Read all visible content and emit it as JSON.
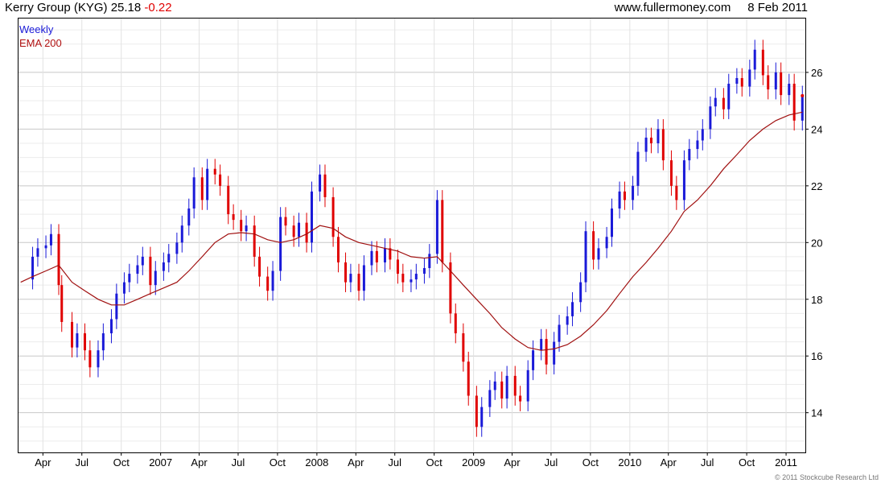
{
  "header": {
    "company": "Kerry Group (KYG)",
    "price": "25.18",
    "change": "-0.22",
    "source": "www.fullermoney.com",
    "date": "8 Feb 2011"
  },
  "legend": {
    "series1": "Weekly",
    "series2": "EMA 200"
  },
  "copyright": "© 2011 Stockcube Research Ltd",
  "colors": {
    "up": "#1a1ad8",
    "down": "#e00000",
    "ema": "#a01010",
    "grid": "#cccccc"
  },
  "chart_data": {
    "type": "line",
    "title": "Kerry Group (KYG) 25.18 -0.22",
    "y_axis_position": "right",
    "ylim": [
      12.6,
      27.9
    ],
    "y_ticks": [
      14,
      16,
      18,
      20,
      22,
      24,
      26
    ],
    "grid": true,
    "legend_placement": "top-left",
    "x_ticks": [
      {
        "label": "Apr",
        "date": "2006-04"
      },
      {
        "label": "Jul",
        "date": "2006-07"
      },
      {
        "label": "Oct",
        "date": "2006-10"
      },
      {
        "label": "2007",
        "date": "2007-01"
      },
      {
        "label": "Apr",
        "date": "2007-04"
      },
      {
        "label": "Jul",
        "date": "2007-07"
      },
      {
        "label": "Oct",
        "date": "2007-10"
      },
      {
        "label": "2008",
        "date": "2008-01"
      },
      {
        "label": "Apr",
        "date": "2008-04"
      },
      {
        "label": "Jul",
        "date": "2008-07"
      },
      {
        "label": "Oct",
        "date": "2008-10"
      },
      {
        "label": "2009",
        "date": "2009-01"
      },
      {
        "label": "Apr",
        "date": "2009-04"
      },
      {
        "label": "Jul",
        "date": "2009-07"
      },
      {
        "label": "Oct",
        "date": "2009-10"
      },
      {
        "label": "2010",
        "date": "2010-01"
      },
      {
        "label": "Apr",
        "date": "2010-04"
      },
      {
        "label": "Jul",
        "date": "2010-07"
      },
      {
        "label": "Oct",
        "date": "2010-10"
      },
      {
        "label": "2011",
        "date": "2011-01"
      }
    ],
    "series": [
      {
        "name": "Weekly",
        "kind": "close",
        "points": [
          [
            "2006-02",
            18.7
          ],
          [
            "2006-03",
            19.5
          ],
          [
            "2006-03-20",
            19.8
          ],
          [
            "2006-04",
            19.9
          ],
          [
            "2006-04-20",
            20.3
          ],
          [
            "2006-05",
            18.5
          ],
          [
            "2006-05-15",
            17.2
          ],
          [
            "2006-06",
            16.3
          ],
          [
            "2006-06-20",
            16.8
          ],
          [
            "2006-07",
            16.2
          ],
          [
            "2006-07-20",
            15.6
          ],
          [
            "2006-08",
            16.2
          ],
          [
            "2006-08-20",
            16.8
          ],
          [
            "2006-09",
            17.3
          ],
          [
            "2006-09-20",
            18.2
          ],
          [
            "2006-10",
            18.6
          ],
          [
            "2006-10-20",
            18.9
          ],
          [
            "2006-11",
            19.2
          ],
          [
            "2006-11-20",
            19.5
          ],
          [
            "2006-12",
            18.5
          ],
          [
            "2006-12-20",
            19.0
          ],
          [
            "2007-01",
            19.3
          ],
          [
            "2007-01-20",
            19.6
          ],
          [
            "2007-02",
            20.0
          ],
          [
            "2007-02-20",
            20.6
          ],
          [
            "2007-03",
            21.2
          ],
          [
            "2007-03-20",
            22.3
          ],
          [
            "2007-04",
            21.5
          ],
          [
            "2007-04-20",
            22.6
          ],
          [
            "2007-05",
            22.4
          ],
          [
            "2007-05-20",
            22.0
          ],
          [
            "2007-06",
            21.0
          ],
          [
            "2007-06-20",
            20.8
          ],
          [
            "2007-07",
            20.4
          ],
          [
            "2007-07-20",
            20.6
          ],
          [
            "2007-08",
            19.5
          ],
          [
            "2007-08-20",
            18.8
          ],
          [
            "2007-09",
            18.3
          ],
          [
            "2007-09-20",
            19.0
          ],
          [
            "2007-10",
            20.9
          ],
          [
            "2007-10-20",
            20.6
          ],
          [
            "2007-11",
            20.2
          ],
          [
            "2007-11-20",
            20.7
          ],
          [
            "2007-12",
            20.0
          ],
          [
            "2007-12-20",
            21.8
          ],
          [
            "2008-01",
            22.4
          ],
          [
            "2008-01-20",
            21.6
          ],
          [
            "2008-02",
            20.2
          ],
          [
            "2008-02-20",
            19.3
          ],
          [
            "2008-03",
            18.6
          ],
          [
            "2008-03-20",
            18.9
          ],
          [
            "2008-04",
            18.3
          ],
          [
            "2008-04-20",
            19.2
          ],
          [
            "2008-05",
            19.7
          ],
          [
            "2008-05-20",
            19.3
          ],
          [
            "2008-06",
            19.8
          ],
          [
            "2008-06-20",
            19.4
          ],
          [
            "2008-07",
            18.9
          ],
          [
            "2008-07-20",
            18.6
          ],
          [
            "2008-08",
            18.7
          ],
          [
            "2008-08-20",
            18.9
          ],
          [
            "2008-09",
            19.1
          ],
          [
            "2008-09-20",
            19.6
          ],
          [
            "2008-10",
            21.5
          ],
          [
            "2008-10-20",
            19.3
          ],
          [
            "2008-11",
            17.5
          ],
          [
            "2008-11-20",
            16.8
          ],
          [
            "2008-12",
            15.8
          ],
          [
            "2008-12-20",
            14.6
          ],
          [
            "2009-01",
            13.5
          ],
          [
            "2009-01-20",
            14.2
          ],
          [
            "2009-02",
            14.8
          ],
          [
            "2009-02-20",
            15.1
          ],
          [
            "2009-03",
            14.5
          ],
          [
            "2009-03-20",
            15.3
          ],
          [
            "2009-04",
            14.6
          ],
          [
            "2009-04-20",
            14.4
          ],
          [
            "2009-05",
            15.5
          ],
          [
            "2009-05-20",
            16.2
          ],
          [
            "2009-06",
            16.6
          ],
          [
            "2009-06-20",
            15.7
          ],
          [
            "2009-07",
            16.5
          ],
          [
            "2009-07-20",
            17.1
          ],
          [
            "2009-08",
            17.4
          ],
          [
            "2009-08-20",
            17.9
          ],
          [
            "2009-09",
            18.6
          ],
          [
            "2009-09-20",
            20.4
          ],
          [
            "2009-10",
            19.4
          ],
          [
            "2009-10-20",
            19.8
          ],
          [
            "2009-11",
            20.2
          ],
          [
            "2009-11-20",
            21.2
          ],
          [
            "2009-12",
            21.8
          ],
          [
            "2009-12-20",
            21.5
          ],
          [
            "2010-01",
            22.0
          ],
          [
            "2010-01-20",
            23.2
          ],
          [
            "2010-02",
            23.7
          ],
          [
            "2010-02-20",
            23.5
          ],
          [
            "2010-03",
            24.0
          ],
          [
            "2010-03-20",
            22.9
          ],
          [
            "2010-04",
            22.0
          ],
          [
            "2010-04-20",
            21.5
          ],
          [
            "2010-05",
            22.9
          ],
          [
            "2010-05-20",
            23.3
          ],
          [
            "2010-06",
            23.6
          ],
          [
            "2010-06-20",
            24.0
          ],
          [
            "2010-07",
            24.8
          ],
          [
            "2010-07-20",
            25.1
          ],
          [
            "2010-08",
            24.7
          ],
          [
            "2010-08-20",
            25.6
          ],
          [
            "2010-09",
            25.8
          ],
          [
            "2010-09-20",
            25.5
          ],
          [
            "2010-10",
            26.1
          ],
          [
            "2010-10-20",
            26.8
          ],
          [
            "2010-11",
            25.9
          ],
          [
            "2010-11-20",
            25.4
          ],
          [
            "2010-12",
            26.0
          ],
          [
            "2010-12-20",
            25.2
          ],
          [
            "2011-01",
            25.6
          ],
          [
            "2011-01-20",
            24.3
          ],
          [
            "2011-02",
            25.18
          ]
        ]
      },
      {
        "name": "EMA 200",
        "points": [
          [
            "2006-02",
            18.6
          ],
          [
            "2006-03",
            18.8
          ],
          [
            "2006-04",
            19.0
          ],
          [
            "2006-05",
            19.2
          ],
          [
            "2006-06",
            18.6
          ],
          [
            "2006-07",
            18.3
          ],
          [
            "2006-08",
            18.0
          ],
          [
            "2006-09",
            17.8
          ],
          [
            "2006-10",
            17.8
          ],
          [
            "2006-11",
            18.0
          ],
          [
            "2006-12",
            18.2
          ],
          [
            "2007-01",
            18.4
          ],
          [
            "2007-02",
            18.6
          ],
          [
            "2007-03",
            19.0
          ],
          [
            "2007-04",
            19.5
          ],
          [
            "2007-05",
            20.0
          ],
          [
            "2007-06",
            20.3
          ],
          [
            "2007-07",
            20.35
          ],
          [
            "2007-08",
            20.3
          ],
          [
            "2007-09",
            20.1
          ],
          [
            "2007-10",
            20.0
          ],
          [
            "2007-11",
            20.1
          ],
          [
            "2007-12",
            20.3
          ],
          [
            "2008-01",
            20.6
          ],
          [
            "2008-02",
            20.5
          ],
          [
            "2008-03",
            20.2
          ],
          [
            "2008-04",
            20.0
          ],
          [
            "2008-05",
            19.9
          ],
          [
            "2008-06",
            19.8
          ],
          [
            "2008-07",
            19.7
          ],
          [
            "2008-08",
            19.5
          ],
          [
            "2008-09",
            19.45
          ],
          [
            "2008-10",
            19.5
          ],
          [
            "2008-11",
            19.0
          ],
          [
            "2008-12",
            18.5
          ],
          [
            "2009-01",
            18.0
          ],
          [
            "2009-02",
            17.5
          ],
          [
            "2009-03",
            17.0
          ],
          [
            "2009-04",
            16.6
          ],
          [
            "2009-05",
            16.3
          ],
          [
            "2009-06",
            16.2
          ],
          [
            "2009-07",
            16.25
          ],
          [
            "2009-08",
            16.4
          ],
          [
            "2009-09",
            16.7
          ],
          [
            "2009-10",
            17.1
          ],
          [
            "2009-11",
            17.6
          ],
          [
            "2009-12",
            18.2
          ],
          [
            "2010-01",
            18.8
          ],
          [
            "2010-02",
            19.3
          ],
          [
            "2010-03",
            19.8
          ],
          [
            "2010-04",
            20.4
          ],
          [
            "2010-05",
            21.1
          ],
          [
            "2010-06",
            21.5
          ],
          [
            "2010-07",
            22.0
          ],
          [
            "2010-08",
            22.6
          ],
          [
            "2010-09",
            23.1
          ],
          [
            "2010-10",
            23.6
          ],
          [
            "2010-11",
            24.0
          ],
          [
            "2010-12",
            24.3
          ],
          [
            "2011-01",
            24.5
          ],
          [
            "2011-02",
            24.6
          ]
        ]
      }
    ]
  }
}
